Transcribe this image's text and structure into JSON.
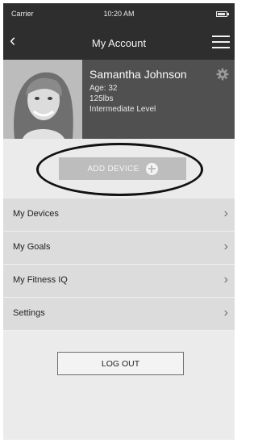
{
  "status_bar": {
    "carrier": "Carrier",
    "time": "10:20 AM",
    "battery_level": 0.85
  },
  "nav": {
    "back_icon": "chevron-left-icon",
    "title": "My Account",
    "menu_icon": "hamburger-icon"
  },
  "profile": {
    "name": "Samantha Johnson",
    "age": "Age: 32",
    "weight": "125lbs",
    "level": "Intermediate Level",
    "settings_icon": "gear-icon"
  },
  "add_device": {
    "label": "ADD DEVICE",
    "icon": "plus-circle-icon"
  },
  "menu_items": [
    {
      "label": "My Devices"
    },
    {
      "label": "My Goals"
    },
    {
      "label": "My Fitness IQ"
    },
    {
      "label": "Settings"
    }
  ],
  "logout": {
    "label": "LOG OUT"
  },
  "colors": {
    "header": "#2e2e2e",
    "profile_bg": "#505050",
    "list_item": "#dcdcdc",
    "screen_bg": "#ebebeb",
    "button_bg": "#bdbdbd"
  }
}
